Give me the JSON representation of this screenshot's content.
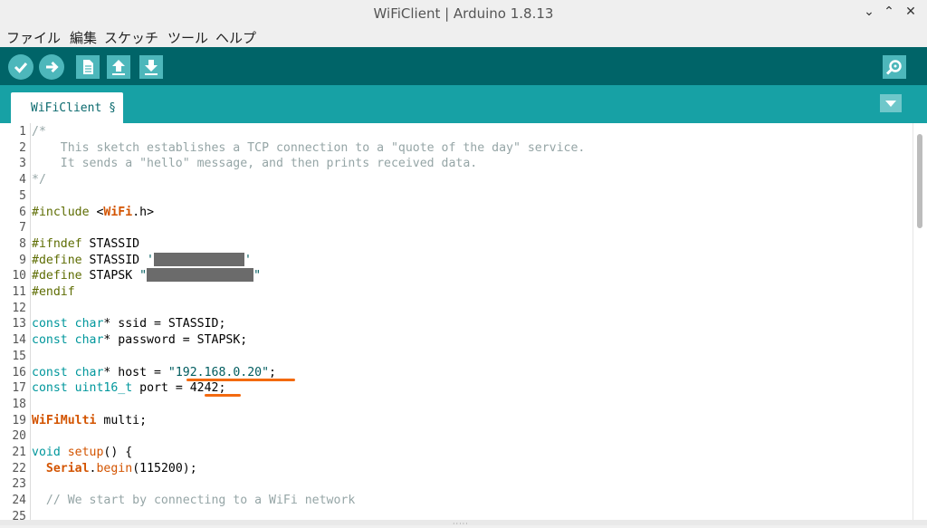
{
  "window": {
    "title": "WiFiClient | Arduino 1.8.13",
    "controls": [
      "⌄",
      "⌃",
      "✕"
    ]
  },
  "menubar": {
    "items": [
      "ファイル",
      "編集",
      "スケッチ",
      "ツール",
      "ヘルプ"
    ]
  },
  "toolbar": {
    "buttons": [
      "verify-icon",
      "upload-icon",
      "new-icon",
      "open-icon",
      "save-icon"
    ],
    "right_button": "serial-monitor-icon"
  },
  "tabs": {
    "active": "WiFiClient §"
  },
  "editor": {
    "line_numbers": [
      "1",
      "2",
      "3",
      "4",
      "5",
      "6",
      "7",
      "8",
      "9",
      "10",
      "11",
      "12",
      "13",
      "14",
      "15",
      "16",
      "17",
      "18",
      "19",
      "20",
      "21",
      "22",
      "23",
      "24",
      "25"
    ],
    "lines": [
      [
        {
          "t": "/*",
          "c": "comment"
        }
      ],
      [
        {
          "t": "    This sketch establishes a TCP connection to a \"quote of the day\" service.",
          "c": "comment"
        }
      ],
      [
        {
          "t": "    It sends a \"hello\" message, and then prints received data.",
          "c": "comment"
        }
      ],
      [
        {
          "t": "*/",
          "c": "comment"
        }
      ],
      [],
      [
        {
          "t": "#include ",
          "c": "pre"
        },
        {
          "t": "<",
          "c": ""
        },
        {
          "t": "WiFi",
          "c": "kw"
        },
        {
          "t": ".h>",
          "c": ""
        }
      ],
      [],
      [
        {
          "t": "#ifndef",
          "c": "pre"
        },
        {
          "t": " STASSID",
          "c": ""
        }
      ],
      [
        {
          "t": "#define",
          "c": "pre"
        },
        {
          "t": " STASSID ",
          "c": ""
        },
        {
          "t": "'",
          "c": "str"
        },
        {
          "r": 100
        },
        {
          "t": "'",
          "c": "str"
        }
      ],
      [
        {
          "t": "#define",
          "c": "pre"
        },
        {
          "t": " STAPSK ",
          "c": ""
        },
        {
          "t": "\"",
          "c": "str"
        },
        {
          "r": 118
        },
        {
          "t": "\"",
          "c": "str"
        }
      ],
      [
        {
          "t": "#endif",
          "c": "pre"
        }
      ],
      [],
      [
        {
          "t": "const",
          "c": "type"
        },
        {
          "t": " ",
          "c": ""
        },
        {
          "t": "char",
          "c": "type"
        },
        {
          "t": "* ssid = STASSID;",
          "c": ""
        }
      ],
      [
        {
          "t": "const",
          "c": "type"
        },
        {
          "t": " ",
          "c": ""
        },
        {
          "t": "char",
          "c": "type"
        },
        {
          "t": "* password = STAPSK;",
          "c": ""
        }
      ],
      [],
      [
        {
          "t": "const",
          "c": "type"
        },
        {
          "t": " ",
          "c": ""
        },
        {
          "t": "char",
          "c": "type"
        },
        {
          "t": "* host = ",
          "c": ""
        },
        {
          "t": "\"192.168.0.20\"",
          "c": "str"
        },
        {
          "t": ";",
          "c": ""
        }
      ],
      [
        {
          "t": "const",
          "c": "type"
        },
        {
          "t": " ",
          "c": ""
        },
        {
          "t": "uint16_t",
          "c": "type"
        },
        {
          "t": " port = 4242;",
          "c": ""
        }
      ],
      [],
      [
        {
          "t": "WiFiMulti",
          "c": "kw"
        },
        {
          "t": " multi;",
          "c": ""
        }
      ],
      [],
      [
        {
          "t": "void",
          "c": "type"
        },
        {
          "t": " ",
          "c": ""
        },
        {
          "t": "setup",
          "c": "fn"
        },
        {
          "t": "() {",
          "c": ""
        }
      ],
      [
        {
          "t": "  ",
          "c": ""
        },
        {
          "t": "Serial",
          "c": "kw"
        },
        {
          "t": ".",
          "c": ""
        },
        {
          "t": "begin",
          "c": "fn"
        },
        {
          "t": "(115200);",
          "c": ""
        }
      ],
      [],
      [
        {
          "t": "  // We start by connecting to a WiFi network",
          "c": "comment"
        }
      ],
      []
    ]
  },
  "colors": {
    "toolbar": "#006468",
    "tabbar": "#17a1a5",
    "highlight_underline": "#f36a10"
  }
}
